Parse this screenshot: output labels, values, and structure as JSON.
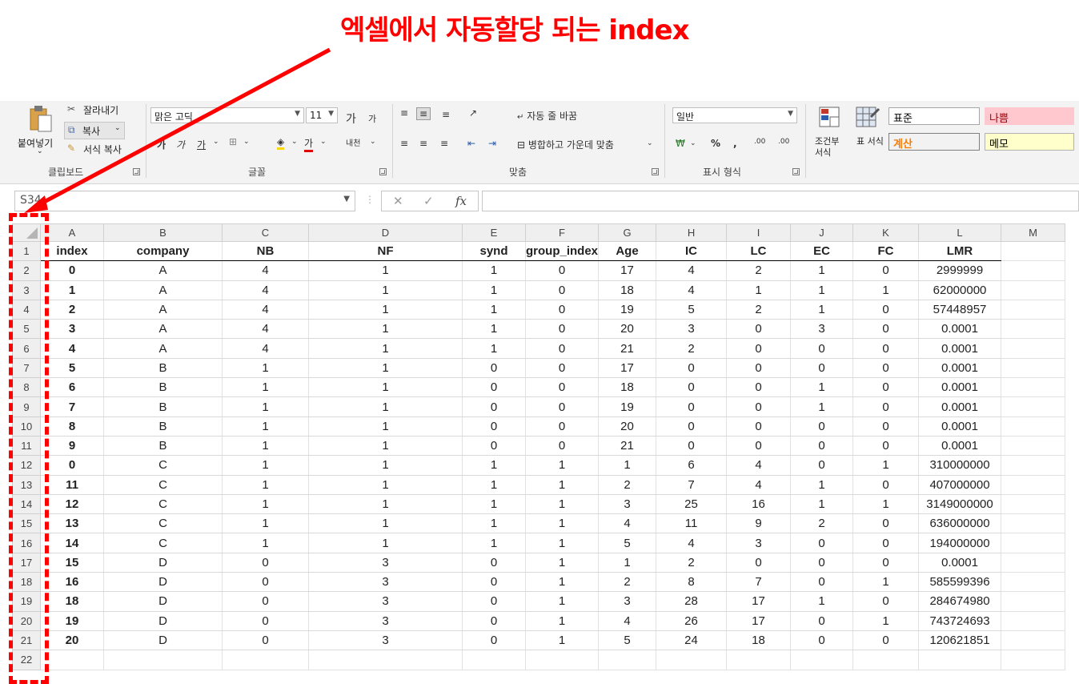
{
  "annotation": {
    "title": "엑셀에서 자동할당 되는 index"
  },
  "ribbon": {
    "clipboard": {
      "paste": "붙여넣기",
      "cut": "잘라내기",
      "copy": "복사",
      "format_painter": "서식 복사",
      "label": "클립보드"
    },
    "font": {
      "name": "맑은 고딕",
      "size": "11",
      "grow": "가",
      "shrink": "가",
      "bold": "가",
      "italic": "가",
      "underline": "가",
      "font_color": "가",
      "phonetic": "내천",
      "label": "글꼴"
    },
    "alignment": {
      "wrap_text": "자동 줄 바꿈",
      "merge_center": "병합하고 가운데 맞춤",
      "label": "맞춤"
    },
    "number": {
      "format": "일반",
      "percent": "%",
      "comma": ",",
      "inc_decimal": ".00",
      "dec_decimal": ".00",
      "label": "표시 형식"
    },
    "styles": {
      "conditional": "조건부 서식",
      "as_table": "표 서식",
      "normal": "표준",
      "bad": "나쁨",
      "calculation": "계산",
      "note": "메모"
    }
  },
  "formula_bar": {
    "name_box": "S34",
    "fx": "fx",
    "cancel": "✕",
    "enter": "✓",
    "value": ""
  },
  "sheet": {
    "columns": [
      "A",
      "B",
      "C",
      "D",
      "E",
      "F",
      "G",
      "H",
      "I",
      "J",
      "K",
      "L",
      "M"
    ],
    "headers": [
      "index",
      "company",
      "NB",
      "NF",
      "synd",
      "group_index",
      "Age",
      "IC",
      "LC",
      "EC",
      "FC",
      "LMR"
    ],
    "rows": [
      [
        "0",
        "A",
        "4",
        "1",
        "1",
        "0",
        "17",
        "4",
        "2",
        "1",
        "0",
        "2999999"
      ],
      [
        "1",
        "A",
        "4",
        "1",
        "1",
        "0",
        "18",
        "4",
        "1",
        "1",
        "1",
        "62000000"
      ],
      [
        "2",
        "A",
        "4",
        "1",
        "1",
        "0",
        "19",
        "5",
        "2",
        "1",
        "0",
        "57448957"
      ],
      [
        "3",
        "A",
        "4",
        "1",
        "1",
        "0",
        "20",
        "3",
        "0",
        "3",
        "0",
        "0.0001"
      ],
      [
        "4",
        "A",
        "4",
        "1",
        "1",
        "0",
        "21",
        "2",
        "0",
        "0",
        "0",
        "0.0001"
      ],
      [
        "5",
        "B",
        "1",
        "1",
        "0",
        "0",
        "17",
        "0",
        "0",
        "0",
        "0",
        "0.0001"
      ],
      [
        "6",
        "B",
        "1",
        "1",
        "0",
        "0",
        "18",
        "0",
        "0",
        "1",
        "0",
        "0.0001"
      ],
      [
        "7",
        "B",
        "1",
        "1",
        "0",
        "0",
        "19",
        "0",
        "0",
        "1",
        "0",
        "0.0001"
      ],
      [
        "8",
        "B",
        "1",
        "1",
        "0",
        "0",
        "20",
        "0",
        "0",
        "0",
        "0",
        "0.0001"
      ],
      [
        "9",
        "B",
        "1",
        "1",
        "0",
        "0",
        "21",
        "0",
        "0",
        "0",
        "0",
        "0.0001"
      ],
      [
        "0",
        "C",
        "1",
        "1",
        "1",
        "1",
        "1",
        "6",
        "4",
        "0",
        "1",
        "310000000"
      ],
      [
        "11",
        "C",
        "1",
        "1",
        "1",
        "1",
        "2",
        "7",
        "4",
        "1",
        "0",
        "407000000"
      ],
      [
        "12",
        "C",
        "1",
        "1",
        "1",
        "1",
        "3",
        "25",
        "16",
        "1",
        "1",
        "3149000000"
      ],
      [
        "13",
        "C",
        "1",
        "1",
        "1",
        "1",
        "4",
        "11",
        "9",
        "2",
        "0",
        "636000000"
      ],
      [
        "14",
        "C",
        "1",
        "1",
        "1",
        "1",
        "5",
        "4",
        "3",
        "0",
        "0",
        "194000000"
      ],
      [
        "15",
        "D",
        "0",
        "3",
        "0",
        "1",
        "1",
        "2",
        "0",
        "0",
        "0",
        "0.0001"
      ],
      [
        "16",
        "D",
        "0",
        "3",
        "0",
        "1",
        "2",
        "8",
        "7",
        "0",
        "1",
        "585599396"
      ],
      [
        "18",
        "D",
        "0",
        "3",
        "0",
        "1",
        "3",
        "28",
        "17",
        "1",
        "0",
        "284674980"
      ],
      [
        "19",
        "D",
        "0",
        "3",
        "0",
        "1",
        "4",
        "26",
        "17",
        "0",
        "1",
        "743724693"
      ],
      [
        "20",
        "D",
        "0",
        "3",
        "0",
        "1",
        "5",
        "24",
        "18",
        "0",
        "0",
        "120621851"
      ]
    ],
    "last_row_number": "22"
  }
}
